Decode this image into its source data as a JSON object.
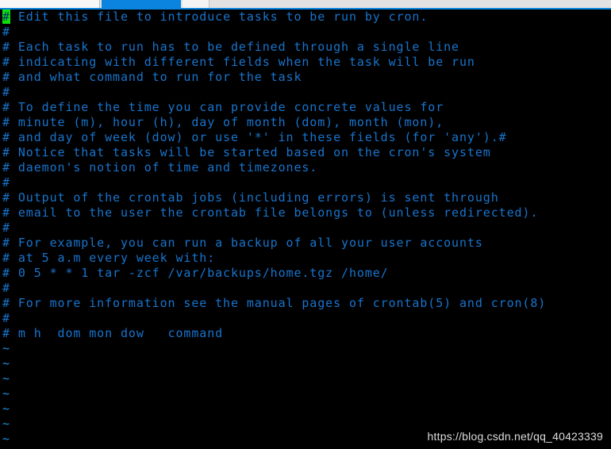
{
  "window": {
    "chrome": {
      "tabs": [
        {
          "name": "tab-inactive-left",
          "label": "",
          "active": false
        },
        {
          "name": "tab-active",
          "label": "",
          "active": true
        },
        {
          "name": "tab-inactive-right",
          "label": "",
          "active": false
        }
      ],
      "accent_color": "#0b84df",
      "bar_color": "#e2e2e2"
    }
  },
  "terminal": {
    "background_color": "#000000",
    "comment_color": "#1874cd",
    "cursor_color": "#0ee00e",
    "cursor": {
      "row": 0,
      "col": 0,
      "char": "#"
    },
    "lines": [
      "# Edit this file to introduce tasks to be run by cron.",
      "#",
      "# Each task to run has to be defined through a single line",
      "# indicating with different fields when the task will be run",
      "# and what command to run for the task",
      "#",
      "# To define the time you can provide concrete values for",
      "# minute (m), hour (h), day of month (dom), month (mon),",
      "# and day of week (dow) or use '*' in these fields (for 'any').#",
      "# Notice that tasks will be started based on the cron's system",
      "# daemon's notion of time and timezones.",
      "#",
      "# Output of the crontab jobs (including errors) is sent through",
      "# email to the user the crontab file belongs to (unless redirected).",
      "#",
      "# For example, you can run a backup of all your user accounts",
      "# at 5 a.m every week with:",
      "# 0 5 * * 1 tar -zcf /var/backups/home.tgz /home/",
      "#",
      "# For more information see the manual pages of crontab(5) and cron(8)",
      "#",
      "# m h  dom mon dow   command"
    ],
    "empty_markers": [
      "~",
      "~",
      "~",
      "~",
      "~",
      "~",
      "~"
    ]
  },
  "watermark": {
    "text": "https://blog.csdn.net/qq_40423339"
  }
}
